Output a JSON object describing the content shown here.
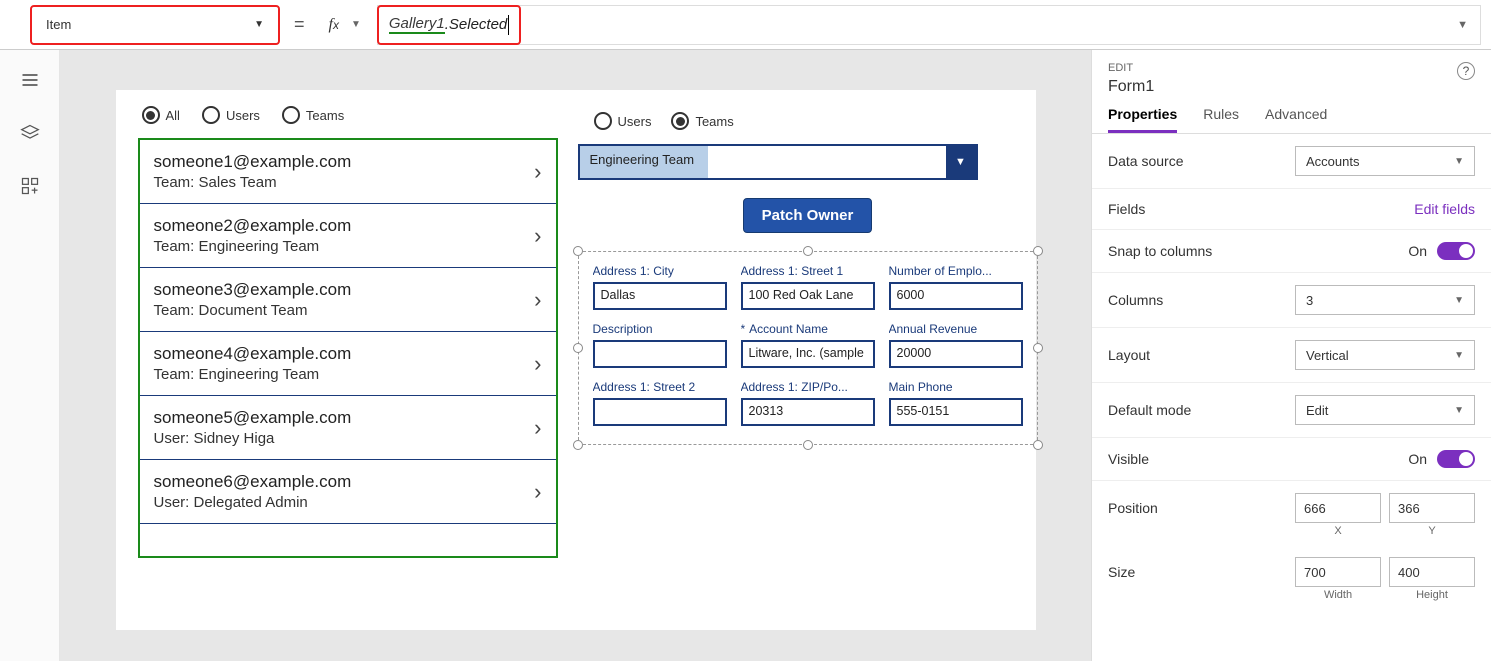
{
  "topbar": {
    "property": "Item",
    "formula_part1": "Gallery1",
    "formula_part2": ".Selected"
  },
  "canvas": {
    "filter_radios": [
      "All",
      "Users",
      "Teams"
    ],
    "gallery": [
      {
        "l1": "someone1@example.com",
        "l2": "Team: Sales Team"
      },
      {
        "l1": "someone2@example.com",
        "l2": "Team: Engineering Team"
      },
      {
        "l1": "someone3@example.com",
        "l2": "Team: Document Team"
      },
      {
        "l1": "someone4@example.com",
        "l2": "Team: Engineering Team"
      },
      {
        "l1": "someone5@example.com",
        "l2": "User: Sidney Higa"
      },
      {
        "l1": "someone6@example.com",
        "l2": "User: Delegated Admin"
      }
    ],
    "owner_radios": [
      "Users",
      "Teams"
    ],
    "dropdown": "Engineering Team",
    "patch_btn": "Patch Owner",
    "form_fields": [
      {
        "label": "Address 1: City",
        "value": "Dallas"
      },
      {
        "label": "Address 1: Street 1",
        "value": "100 Red Oak Lane"
      },
      {
        "label": "Number of Emplo...",
        "value": "6000"
      },
      {
        "label": "Description",
        "value": ""
      },
      {
        "label": "Account Name",
        "value": "Litware, Inc. (sample",
        "req": true
      },
      {
        "label": "Annual Revenue",
        "value": "20000"
      },
      {
        "label": "Address 1: Street 2",
        "value": ""
      },
      {
        "label": "Address 1: ZIP/Po...",
        "value": "20313"
      },
      {
        "label": "Main Phone",
        "value": "555-0151"
      }
    ]
  },
  "panel": {
    "edit_label": "EDIT",
    "title": "Form1",
    "tabs": [
      "Properties",
      "Rules",
      "Advanced"
    ],
    "datasource_lab": "Data source",
    "datasource_val": "Accounts",
    "fields_lab": "Fields",
    "fields_link": "Edit fields",
    "snap_lab": "Snap to columns",
    "snap_val": "On",
    "columns_lab": "Columns",
    "columns_val": "3",
    "layout_lab": "Layout",
    "layout_val": "Vertical",
    "defmode_lab": "Default mode",
    "defmode_val": "Edit",
    "visible_lab": "Visible",
    "visible_val": "On",
    "position_lab": "Position",
    "pos_x": "666",
    "pos_y": "366",
    "x_lab": "X",
    "y_lab": "Y",
    "size_lab": "Size",
    "size_w": "700",
    "size_h": "400",
    "w_lab": "Width",
    "h_lab": "Height"
  }
}
